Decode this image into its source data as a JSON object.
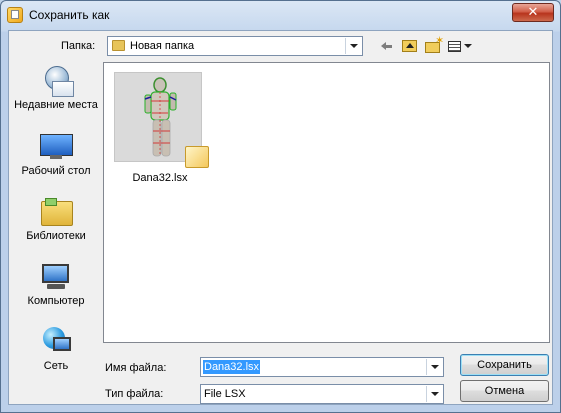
{
  "window": {
    "title": "Сохранить как",
    "close_glyph": "✕"
  },
  "toolbar": {
    "look_in_label": "Папка:",
    "look_in_value": "Новая папка",
    "icons": [
      "back-arrow-icon",
      "up-folder-icon",
      "new-folder-icon",
      "view-menu-icon"
    ]
  },
  "places": [
    {
      "label": "Недавние места",
      "icon": "recent-places-icon"
    },
    {
      "label": "Рабочий стол",
      "icon": "desktop-icon"
    },
    {
      "label": "Библиотеки",
      "icon": "libraries-icon"
    },
    {
      "label": "Компьютер",
      "icon": "computer-icon"
    },
    {
      "label": "Сеть",
      "icon": "network-icon"
    }
  ],
  "files": [
    {
      "name": "Dana32.lsx",
      "icon": "lsx-file-thumbnail"
    }
  ],
  "filename": {
    "label": "Имя файла:",
    "value": "Dana32.lsx"
  },
  "filetype": {
    "label": "Тип файла:",
    "value": "File LSX"
  },
  "buttons": {
    "save": "Сохранить",
    "cancel": "Отмена"
  }
}
